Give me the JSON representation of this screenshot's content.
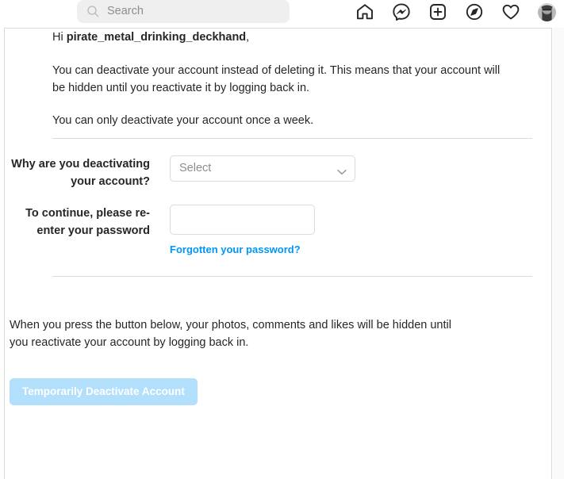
{
  "navbar": {
    "search": {
      "placeholder": "Search",
      "value": "",
      "icon": "search-icon"
    },
    "icons": [
      {
        "name": "home-icon",
        "label": "Home"
      },
      {
        "name": "messenger-icon",
        "label": "Messenger"
      },
      {
        "name": "new-post-icon",
        "label": "New post"
      },
      {
        "name": "explore-icon",
        "label": "Explore"
      },
      {
        "name": "heart-icon",
        "label": "Notifications"
      },
      {
        "name": "profile-avatar",
        "label": "Profile"
      }
    ]
  },
  "page": {
    "greeting_prefix": "Hi ",
    "username": "pirate_metal_drinking_deckhand",
    "greeting_suffix": ",",
    "paragraph_1": "You can deactivate your account instead of deleting it. This means that your account will be hidden until you reactivate it by logging back in.",
    "paragraph_2": "You can only deactivate your account once a week.",
    "footer_paragraph": "When you press the button below, your photos, comments and likes will be hidden until you reactivate your account by logging back in."
  },
  "form": {
    "reason": {
      "label": "Why are you deactivating your account?",
      "selected": "Select",
      "options": [
        "Select"
      ]
    },
    "password": {
      "label": "To continue, please re-enter your password",
      "value": "",
      "placeholder": ""
    },
    "forgot_password_link": "Forgotten your password?"
  },
  "actions": {
    "deactivate_button": "Temporarily Deactivate Account"
  },
  "colors": {
    "link_blue": "#0095f6",
    "button_disabled_blue": "#b2dffc",
    "border_gray": "#dbdbdb",
    "text_primary": "#262626",
    "placeholder_gray": "#8e8e8e"
  }
}
